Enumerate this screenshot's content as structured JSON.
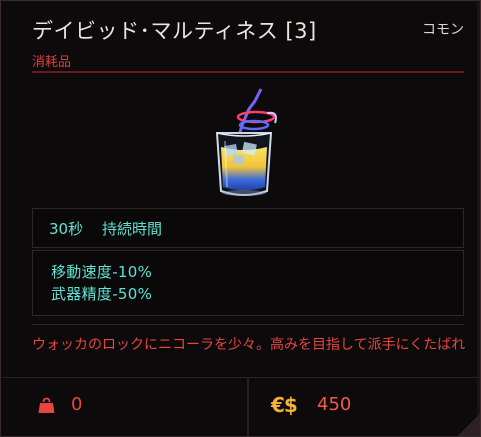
{
  "item": {
    "name": "デイビッド･マルティネス [3]",
    "rarity": "コモン",
    "category": "消耗品",
    "duration": {
      "value": "30秒",
      "label": "持続時間"
    },
    "stats": [
      "移動速度-10%",
      "武器精度-50%"
    ],
    "description": "ウォッカのロックにニコーラを少々。高みを目指して派手にくたばれ",
    "weight": "0",
    "price": "450",
    "currency_symbol": "€$"
  },
  "colors": {
    "accent_red": "#e8453e",
    "stat_cyan": "#5fe3d5",
    "currency_gold": "#f2b23a"
  },
  "icons": {
    "weight": "weight-bag-icon",
    "currency": "eddies-icon"
  }
}
